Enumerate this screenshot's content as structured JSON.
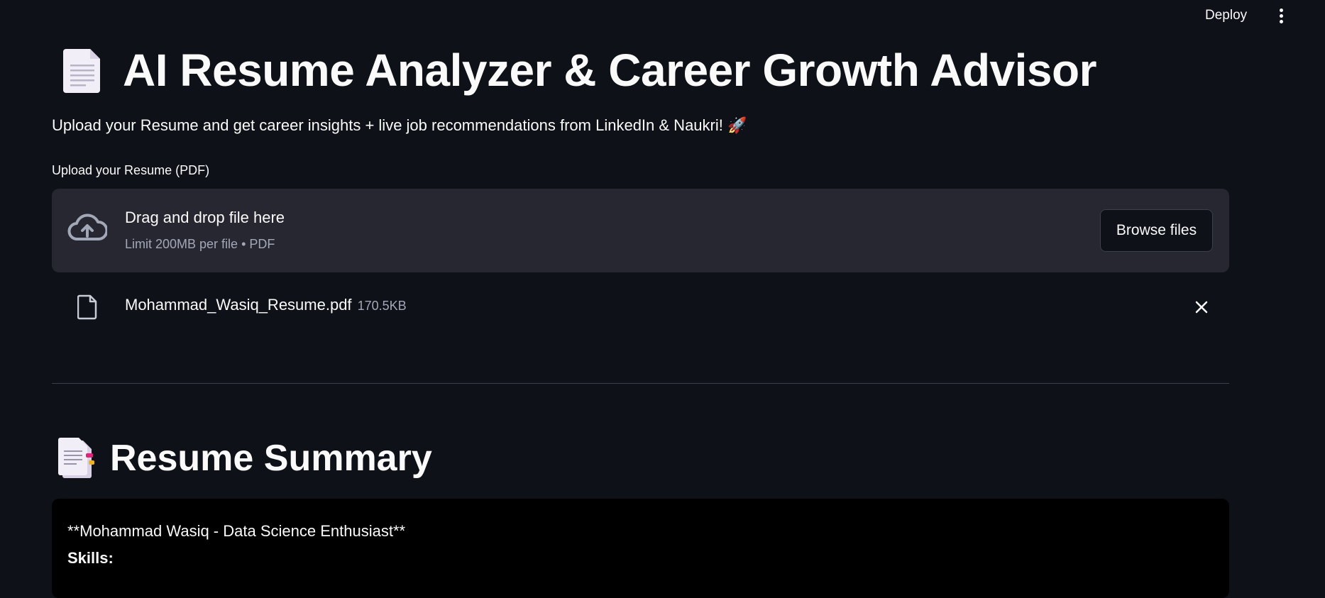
{
  "header": {
    "deploy_label": "Deploy",
    "menu_icon": "vertical-dots-icon"
  },
  "main": {
    "title_icon": "page-facing-up-icon",
    "title": "AI Resume Analyzer & Career Growth Advisor",
    "subtitle": "Upload your Resume and get career insights + live job recommendations from LinkedIn & Naukri! 🚀",
    "uploader": {
      "label": "Upload your Resume (PDF)",
      "dropzone_text": "Drag and drop file here",
      "limit_text": "Limit 200MB per file • PDF",
      "browse_label": "Browse files",
      "icon": "cloud-upload-icon"
    },
    "uploaded_file": {
      "name": "Mohammad_Wasiq_Resume.pdf",
      "size": "170.5KB",
      "icon": "file-icon",
      "remove_icon": "close-icon"
    },
    "summary": {
      "icon": "bookmark-tabs-icon",
      "title": "Resume Summary",
      "lines": [
        "**Mohammad Wasiq - Data Science Enthusiast**",
        "Skills:"
      ]
    }
  },
  "colors": {
    "background": "#0e1117",
    "dropzone": "#262730",
    "text": "#fafafa",
    "muted": "#a3a8b8",
    "summary_bg": "#000000"
  }
}
